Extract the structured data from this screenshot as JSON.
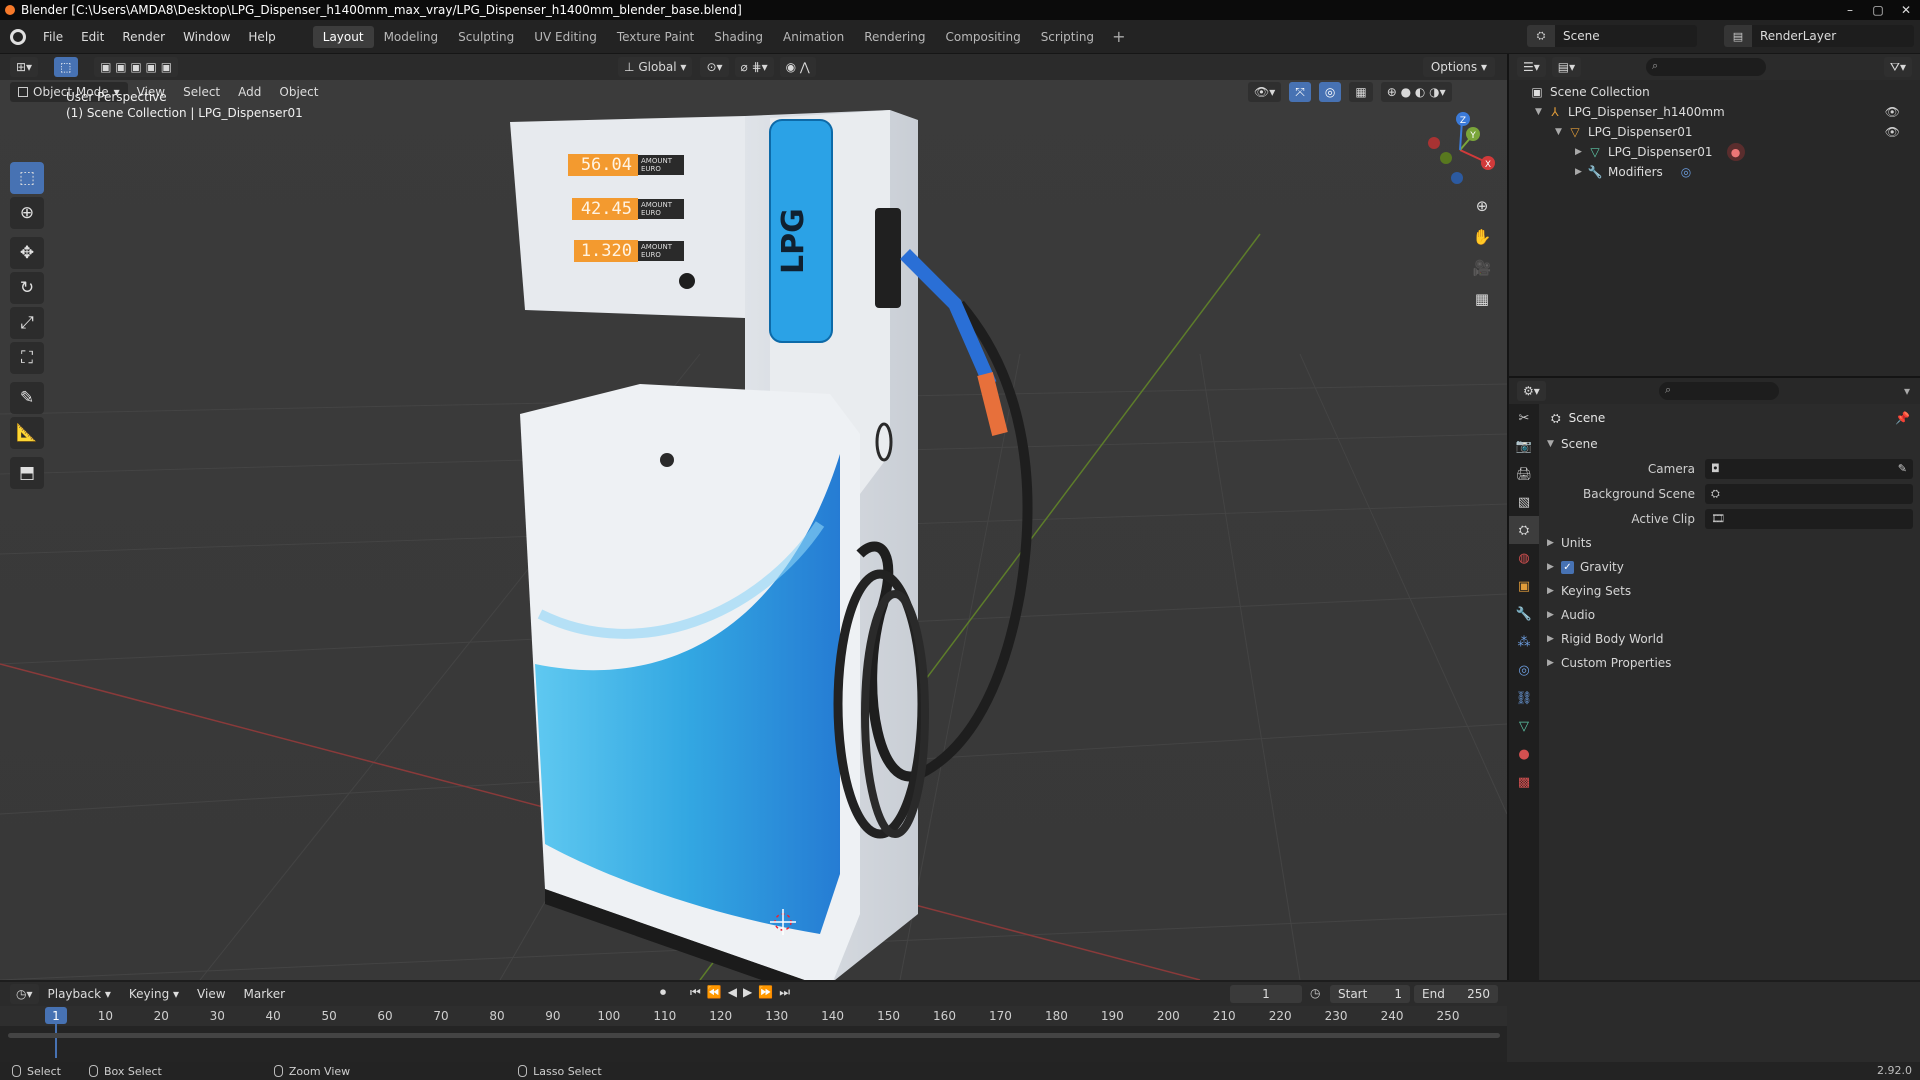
{
  "window": {
    "title": "Blender [C:\\Users\\AMDA8\\Desktop\\LPG_Dispenser_h1400mm_max_vray/LPG_Dispenser_h1400mm_blender_base.blend]"
  },
  "menu": {
    "items": [
      "File",
      "Edit",
      "Render",
      "Window",
      "Help"
    ]
  },
  "workspaces": {
    "tabs": [
      "Layout",
      "Modeling",
      "Sculpting",
      "UV Editing",
      "Texture Paint",
      "Shading",
      "Animation",
      "Rendering",
      "Compositing",
      "Scripting"
    ],
    "active": "Layout",
    "add": "+"
  },
  "scene_selector": {
    "value": "Scene"
  },
  "renderlayer_selector": {
    "value": "RenderLayer"
  },
  "viewport": {
    "transform_orientation": "Global",
    "options_label": "Options",
    "mode": "Object Mode",
    "header_menu": [
      "View",
      "Select",
      "Add",
      "Object"
    ],
    "overlay_line1": "User Perspective",
    "overlay_line2": "(1) Scene Collection | LPG_Dispenser01",
    "gizmo": {
      "x": "X",
      "y": "Y",
      "z": "Z"
    }
  },
  "model": {
    "display1": "56.04",
    "display2": "42.45",
    "display3": "1.320",
    "amount_label": "AMOUNT",
    "unit_label": "EURO",
    "brand": "LPG",
    "body_color": "#eef1f4",
    "accent_color": "#1e9fe0",
    "display_color": "#f39a2f",
    "hose_color": "#1e1e1e",
    "nozzle_blue": "#2a6fd6",
    "nozzle_orange": "#e7703b"
  },
  "outliner": {
    "root": "Scene Collection",
    "items": [
      {
        "label": "LPG_Dispenser_h1400mm",
        "icon": "armature-icon"
      },
      {
        "label": "LPG_Dispenser01",
        "icon": "object-icon"
      },
      {
        "label": "LPG_Dispenser01",
        "icon": "mesh-icon"
      },
      {
        "label": "Modifiers",
        "icon": "wrench-icon"
      }
    ]
  },
  "properties": {
    "title": "Scene",
    "panel": "Scene",
    "rows": [
      {
        "label": "Camera"
      },
      {
        "label": "Background Scene"
      },
      {
        "label": "Active Clip"
      }
    ],
    "subpanels": [
      "Units",
      "Gravity",
      "Keying Sets",
      "Audio",
      "Rigid Body World",
      "Custom Properties"
    ],
    "gravity_checked": true
  },
  "timeline": {
    "menu": [
      "Playback",
      "Keying",
      "View",
      "Marker"
    ],
    "current_frame": "1",
    "start_label": "Start",
    "start": "1",
    "end_label": "End",
    "end": "250",
    "ruler": [
      "10",
      "20",
      "30",
      "40",
      "50",
      "60",
      "70",
      "80",
      "90",
      "100",
      "110",
      "120",
      "130",
      "140",
      "150",
      "160",
      "170",
      "180",
      "190",
      "200",
      "210",
      "220",
      "230",
      "240",
      "250"
    ],
    "playhead": "1"
  },
  "statusbar": {
    "select": "Select",
    "box_select": "Box Select",
    "zoom_view": "Zoom View",
    "lasso_select": "Lasso Select",
    "version": "2.92.0"
  },
  "colors": {
    "accent": "#4772b3",
    "viewport_bg": "#3a3a3a",
    "panel_bg": "#2b2b2b"
  }
}
